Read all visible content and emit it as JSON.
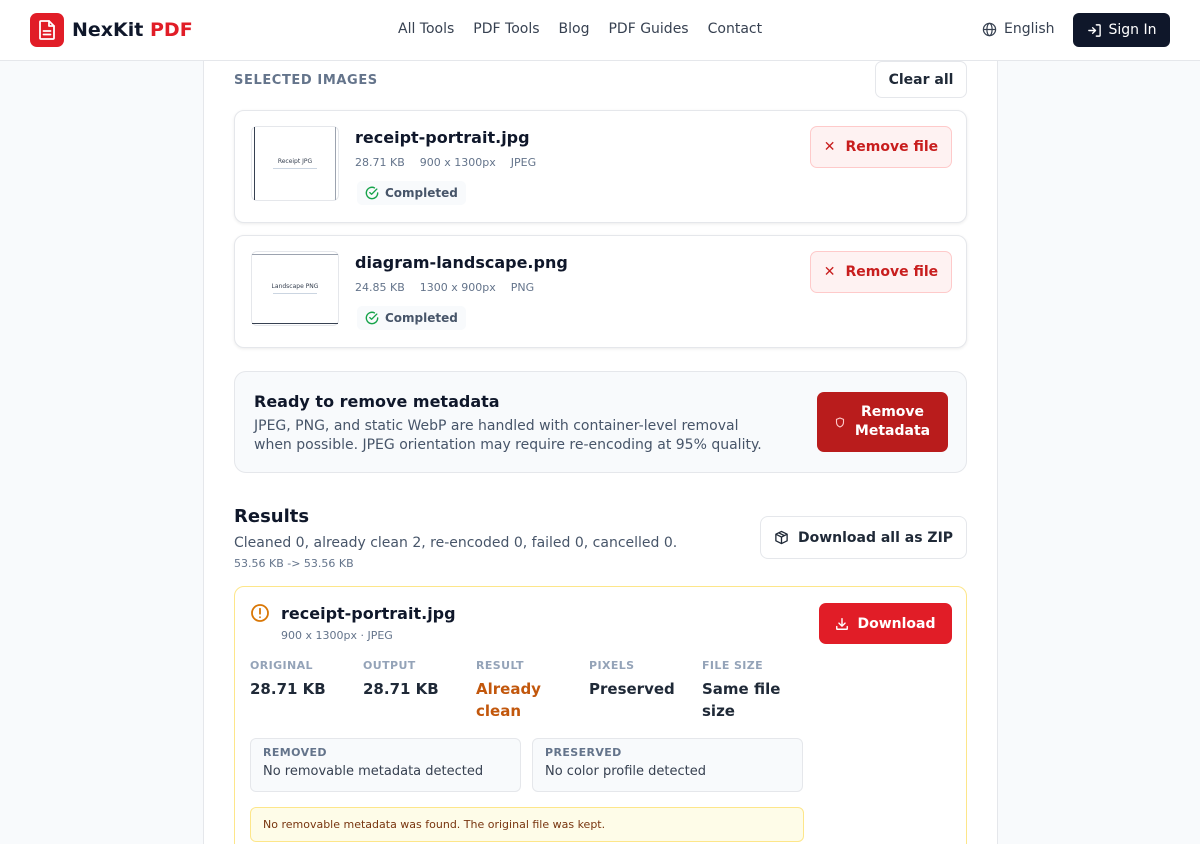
{
  "header": {
    "brand": "NexKit",
    "brand_accent": "PDF",
    "nav": [
      "All Tools",
      "PDF Tools",
      "Blog",
      "PDF Guides",
      "Contact"
    ],
    "language": "English",
    "sign_in": "Sign In"
  },
  "selected": {
    "label": "SELECTED IMAGES",
    "clear_all": "Clear all",
    "files": [
      {
        "name": "receipt-portrait.jpg",
        "size": "28.71 KB",
        "dimensions": "900 x 1300px",
        "format": "JPEG",
        "status": "Completed",
        "remove_label": "Remove file",
        "thumb_title": "Receipt JPG"
      },
      {
        "name": "diagram-landscape.png",
        "size": "24.85 KB",
        "dimensions": "1300 x 900px",
        "format": "PNG",
        "status": "Completed",
        "remove_label": "Remove file",
        "thumb_title": "Landscape PNG"
      }
    ]
  },
  "ready": {
    "title": "Ready to remove metadata",
    "description": "JPEG, PNG, and static WebP are handled with container-level removal when possible. JPEG orientation may require re-encoding at 95% quality.",
    "button_line1": "Remove",
    "button_line2": "Metadata"
  },
  "results": {
    "title": "Results",
    "summary": "Cleaned 0, already clean 2, re-encoded 0, failed 0, cancelled 0.",
    "size_change": "53.56 KB -> 53.56 KB",
    "zip_label": "Download all as ZIP",
    "item": {
      "name": "receipt-portrait.jpg",
      "meta": "900 x 1300px · JPEG",
      "download_label": "Download",
      "stats": [
        {
          "label": "ORIGINAL",
          "value": "28.71 KB"
        },
        {
          "label": "OUTPUT",
          "value": "28.71 KB"
        },
        {
          "label": "RESULT",
          "value": "Already clean"
        },
        {
          "label": "PIXELS",
          "value": "Preserved"
        },
        {
          "label": "FILE SIZE",
          "value": "Same file size"
        }
      ],
      "removed_label": "REMOVED",
      "removed_value": "No removable metadata detected",
      "preserved_label": "PRESERVED",
      "preserved_value": "No color profile detected",
      "note": "No removable metadata was found. The original file was kept."
    }
  },
  "colors": {
    "brand": "#e11d27",
    "warning": "#c2570c",
    "success": "#16a34a",
    "dark": "#0f172a"
  }
}
